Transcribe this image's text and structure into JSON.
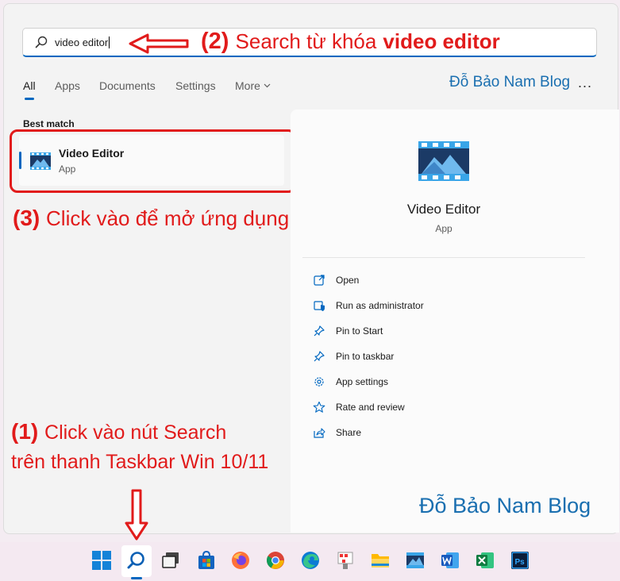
{
  "search": {
    "value": "video editor"
  },
  "tabs": [
    {
      "label": "All",
      "active": true
    },
    {
      "label": "Apps"
    },
    {
      "label": "Documents"
    },
    {
      "label": "Settings"
    },
    {
      "label": "More"
    }
  ],
  "blog_top": "Đỗ Bảo Nam Blog",
  "more_menu": "...",
  "best_match": {
    "heading": "Best match",
    "title": "Video Editor",
    "subtitle": "App"
  },
  "detail": {
    "title": "Video Editor",
    "subtitle": "App",
    "actions": [
      {
        "label": "Open",
        "icon": "open-external-icon"
      },
      {
        "label": "Run as administrator",
        "icon": "shield-icon"
      },
      {
        "label": "Pin to Start",
        "icon": "pin-icon"
      },
      {
        "label": "Pin to taskbar",
        "icon": "pin-icon"
      },
      {
        "label": "App settings",
        "icon": "gear-icon"
      },
      {
        "label": "Rate and review",
        "icon": "star-icon"
      },
      {
        "label": "Share",
        "icon": "share-icon"
      }
    ]
  },
  "blog_bottom": "Đỗ Bảo Nam Blog",
  "annotations": {
    "step2_num": "(2)",
    "step2_text": "Search từ khóa",
    "step2_bold": "video editor",
    "step3_num": "(3)",
    "step3_text": "Click vào để mở ứng dụng",
    "step1_num": "(1)",
    "step1_text": "Click vào nút Search",
    "step1_line2": "trên thanh Taskbar Win 10/11"
  },
  "taskbar": {
    "icons": [
      "windows-start-icon",
      "search-icon",
      "task-view-icon",
      "microsoft-store-icon",
      "firefox-icon",
      "chrome-icon",
      "edge-icon",
      "app-icon",
      "file-explorer-icon",
      "video-editor-icon",
      "word-icon",
      "excel-icon",
      "photoshop-icon"
    ]
  },
  "colors": {
    "accent": "#0067c0",
    "annotation": "#e11b1b",
    "blog": "#1a6fb0"
  }
}
